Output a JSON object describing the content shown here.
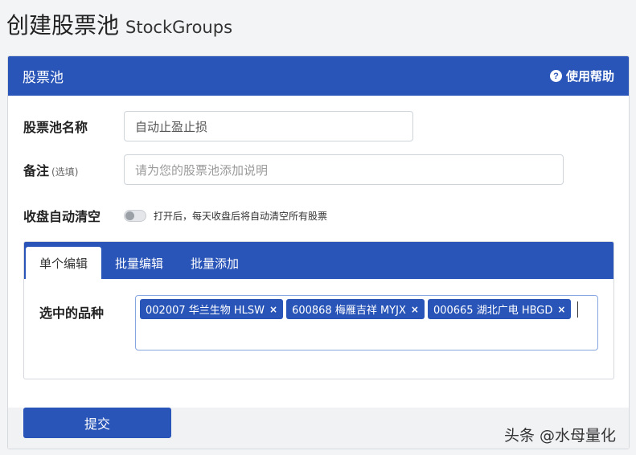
{
  "page_title": {
    "zh": "创建股票池",
    "en": "StockGroups"
  },
  "card": {
    "title": "股票池",
    "help_label": "使用帮助",
    "help_icon": "question-circle-icon"
  },
  "form": {
    "name_label": "股票池名称",
    "name_value": "自动止盈止损",
    "note_label": "备注",
    "note_optional": "(选填)",
    "note_placeholder": "请为您的股票池添加说明",
    "auto_clear_label": "收盘自动清空",
    "auto_clear_on": false,
    "auto_clear_desc": "打开后，每天收盘后将自动清空所有股票"
  },
  "tabs": [
    {
      "label": "单个编辑",
      "active": true
    },
    {
      "label": "批量编辑",
      "active": false
    },
    {
      "label": "批量添加",
      "active": false
    }
  ],
  "selected": {
    "label": "选中的品种",
    "tags": [
      {
        "text": "002007 华兰生物 HLSW",
        "remove": "×"
      },
      {
        "text": "600868 梅雁吉祥 MYJX",
        "remove": "×"
      },
      {
        "text": "000665 湖北广电 HBGD",
        "remove": "×"
      }
    ]
  },
  "submit_label": "提交",
  "watermark": "头条 @水母量化",
  "colors": {
    "primary": "#2a55b8",
    "background": "#f3f4f6"
  }
}
